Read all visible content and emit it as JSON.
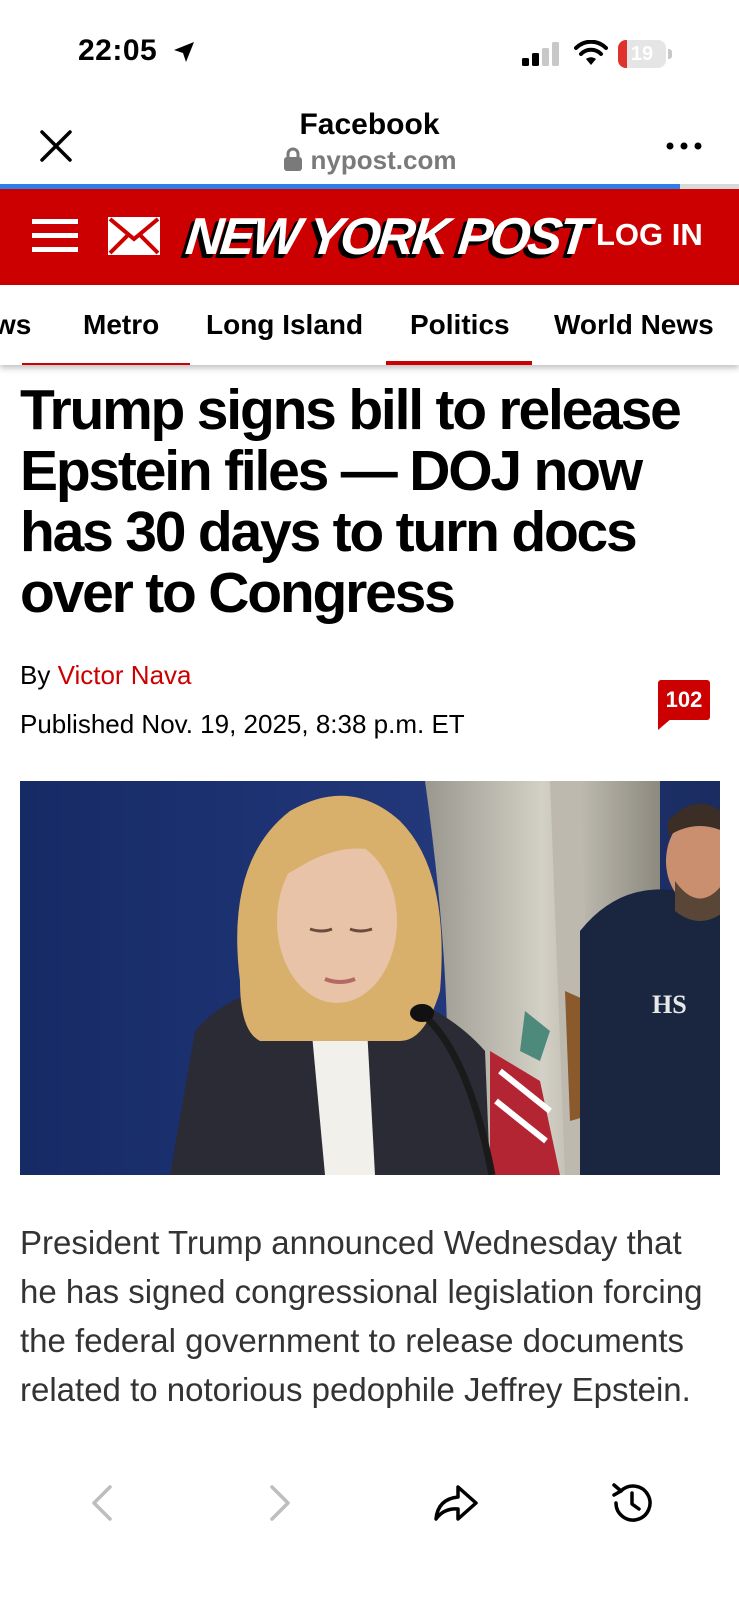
{
  "status_bar": {
    "time": "22:05",
    "battery_level": "19",
    "battery_fraction": 0.19
  },
  "browser": {
    "title": "Facebook",
    "url": "nypost.com",
    "load_progress": 0.92
  },
  "site": {
    "logo_text": "NEW YORK POST",
    "login_label": "LOG IN",
    "brand_color": "#cc0000"
  },
  "nav": {
    "items": [
      "ws",
      "Metro",
      "Long Island",
      "Politics",
      "World News"
    ],
    "active": "Politics"
  },
  "article": {
    "headline": "Trump signs bill to release Epstein files — DOJ now has 30 days to turn docs over to Congress",
    "byline_prefix": "By",
    "author": "Victor Nava",
    "published": "Published Nov. 19, 2025, 8:38 p.m. ET",
    "comment_count": "102",
    "body": "President Trump announced Wednesday that he has signed congressional legislation forcing the federal government to release documents related to notorious pedophile Jeffrey Epstein.",
    "image_text": "HS"
  },
  "icons": [
    "location-arrow-icon",
    "signal-icon",
    "wifi-icon",
    "battery-icon",
    "close-icon",
    "lock-icon",
    "more-icon",
    "menu-icon",
    "mail-icon",
    "back-icon",
    "forward-icon",
    "share-icon",
    "history-icon"
  ]
}
